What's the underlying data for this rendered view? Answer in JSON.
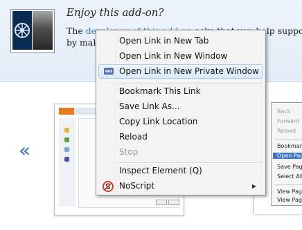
{
  "banner": {
    "title": "Enjoy this add-on?",
    "text_prefix": "The ",
    "link_text": "developer of this add-on",
    "text_suffix": " asks that you help support its c",
    "line2": "by mak"
  },
  "gallery": {
    "prev_label": "«"
  },
  "screenshot_menu": {
    "items": [
      "Back",
      "Forward",
      "Reload",
      "Bookmark",
      "Open Pag",
      "Save Pag",
      "Select All",
      "View Page",
      "View Page"
    ]
  },
  "context_menu": {
    "items": [
      {
        "label": "Open Link in New Tab"
      },
      {
        "label": "Open Link in New Window"
      },
      {
        "label": "Open Link in New Private Window",
        "icon": "private-window-icon"
      },
      {
        "label": "Bookmark This Link"
      },
      {
        "label": "Save Link As..."
      },
      {
        "label": "Copy Link Location"
      },
      {
        "label": "Reload"
      },
      {
        "label": "Stop"
      },
      {
        "label": "Inspect Element (Q)"
      },
      {
        "label": "NoScript",
        "icon": "noscript-icon"
      }
    ]
  },
  "colors": {
    "banner_bg": "#e3ecf7",
    "link": "#3a76b8",
    "hover_border": "#aecbef",
    "selection": "#3d75c3"
  }
}
